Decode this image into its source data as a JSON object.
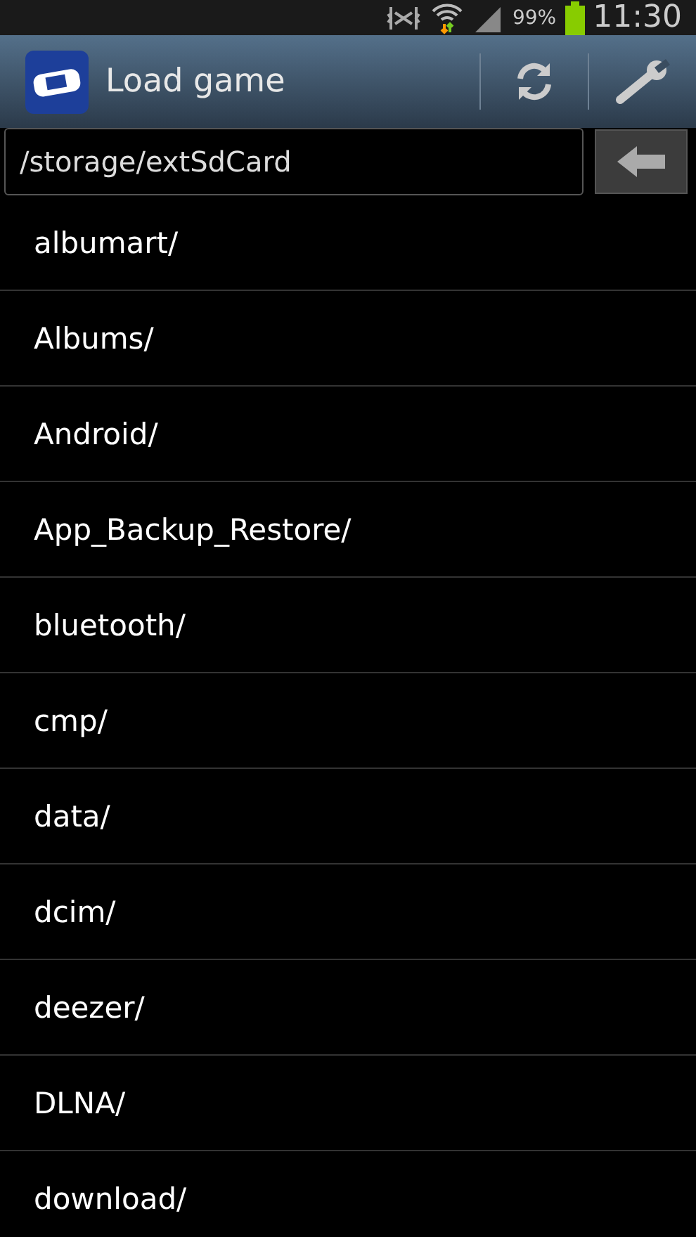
{
  "status_bar": {
    "battery": "99%",
    "time": "11:30"
  },
  "action_bar": {
    "title": "Load game"
  },
  "path": {
    "value": "/storage/extSdCard"
  },
  "items": [
    {
      "label": "albumart/"
    },
    {
      "label": "Albums/"
    },
    {
      "label": "Android/"
    },
    {
      "label": "App_Backup_Restore/"
    },
    {
      "label": "bluetooth/"
    },
    {
      "label": "cmp/"
    },
    {
      "label": "data/"
    },
    {
      "label": "dcim/"
    },
    {
      "label": "deezer/"
    },
    {
      "label": "DLNA/"
    },
    {
      "label": "download/"
    }
  ]
}
